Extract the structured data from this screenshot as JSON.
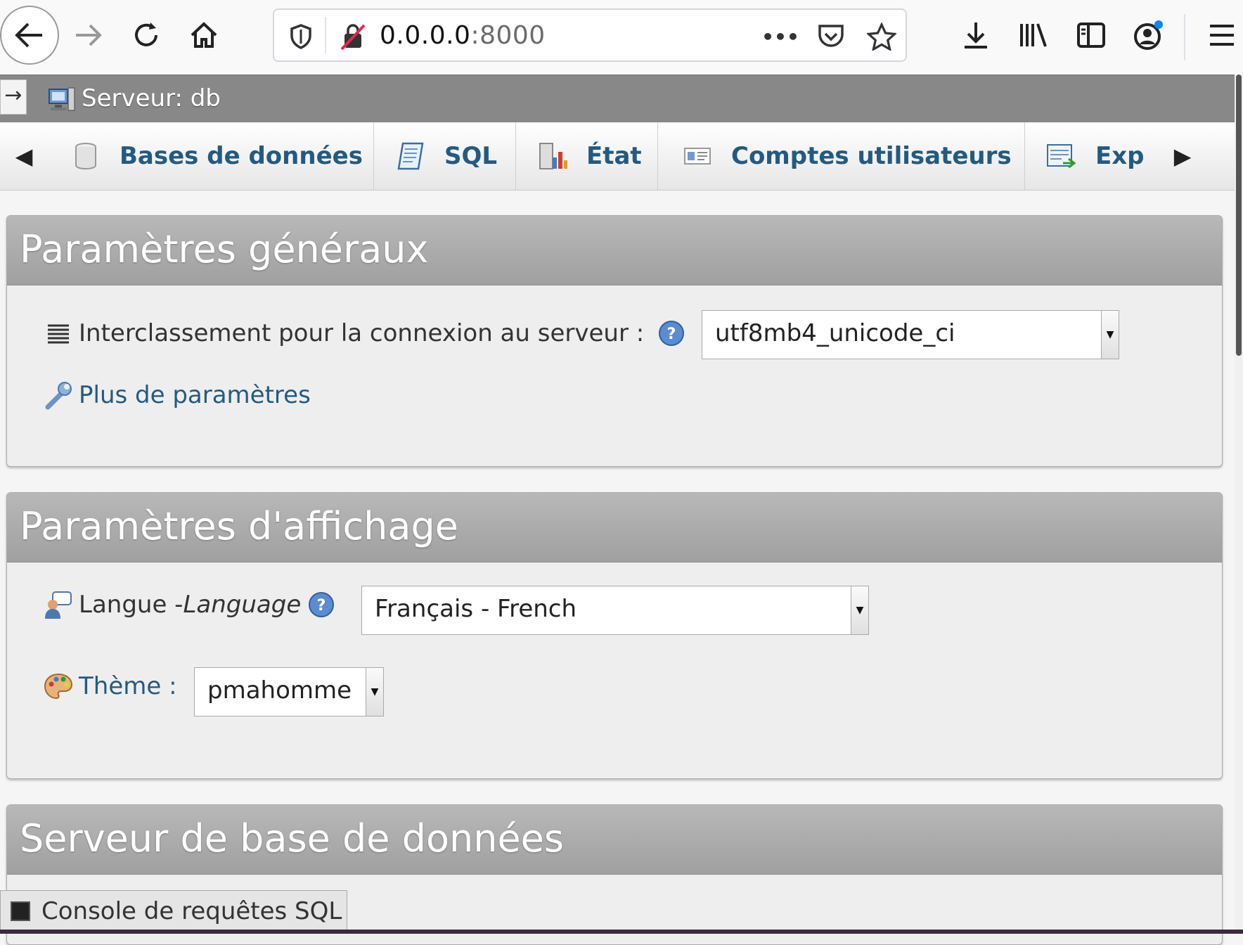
{
  "browser": {
    "url_host": "0.0.0.0",
    "url_port": ":8000",
    "more_icon": "•••"
  },
  "server_header": {
    "collapse_symbol": "→",
    "label": "Serveur: db"
  },
  "tabs": {
    "scroll_left": "◀",
    "scroll_right": "▶",
    "items": [
      {
        "label": "Bases de données",
        "icon": "database-icon"
      },
      {
        "label": "SQL",
        "icon": "sql-icon"
      },
      {
        "label": "État",
        "icon": "status-icon"
      },
      {
        "label": "Comptes utilisateurs",
        "icon": "users-icon"
      },
      {
        "label": "Exp",
        "icon": "export-icon"
      }
    ]
  },
  "general_settings": {
    "title": "Paramètres généraux",
    "collation_label": "Interclassement pour la connexion au serveur :",
    "collation_value": "utf8mb4_unicode_ci",
    "more_settings_link": "Plus de paramètres"
  },
  "display_settings": {
    "title": "Paramètres d'affichage",
    "language_label": "Langue - ",
    "language_label_italic": "Language",
    "language_value": "Français - French",
    "theme_label": "Thème :",
    "theme_value": "pmahomme"
  },
  "db_server": {
    "title": "Serveur de base de données"
  },
  "console": {
    "label": "Console de requêtes SQL"
  },
  "colors": {
    "link": "#235a81",
    "panel_header": "#a8a8a8",
    "server_header": "#888888"
  }
}
